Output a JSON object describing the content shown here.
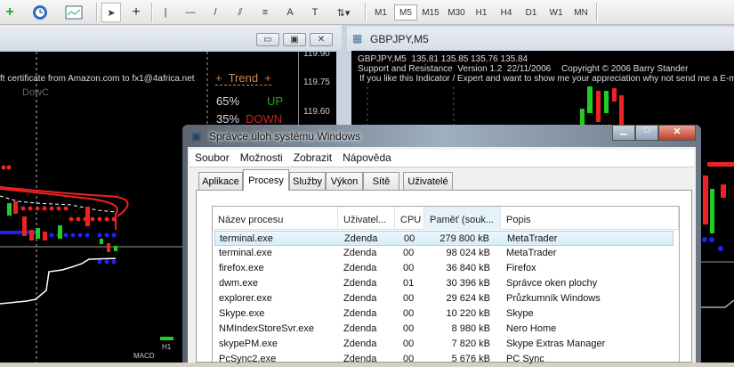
{
  "toolbar": {
    "icons": [
      "new-chart-icon",
      "clock-icon",
      "indicators-icon",
      "cursor-icon",
      "crosshair-icon",
      "vertical-line-icon",
      "horizontal-line-icon",
      "trendline-icon",
      "equidistant-channel-icon",
      "fibonacci-icon",
      "text-icon",
      "text-label-icon",
      "arrows-icon"
    ],
    "text_tool": "A",
    "timeframes": [
      "M1",
      "M5",
      "M15",
      "M30",
      "H1",
      "H4",
      "D1",
      "W1",
      "MN"
    ],
    "active_timeframe": "M5"
  },
  "left_chart": {
    "banner": "ft certificate   from Amazon.com to fx1@4africa.net",
    "dow_label": "DowC",
    "trend_title": "+  Trend  +",
    "up_pct": "65%",
    "up_label": "UP",
    "down_pct": "35%",
    "down_label": "DOWN",
    "prices": [
      "119.90",
      "119.75",
      "119.60"
    ],
    "macd_label": "MACD",
    "h1_label": "H1"
  },
  "right_chart": {
    "title": "GBPJPY,M5",
    "line1": "GBPJPY,M5  135.81 135.85 135.76 135.84",
    "line2": "Support and Resistance  Version 1.2  22/11/2006",
    "copyright": "Copyright © 2006 Barry Stander",
    "line3": "If you like this Indicator / Expert and want to show me your appreciation why not send me a   E-mail"
  },
  "taskmgr": {
    "title": "Správce úloh systému Windows",
    "menu": [
      "Soubor",
      "Možnosti",
      "Zobrazit",
      "Nápověda"
    ],
    "tabs": [
      "Aplikace",
      "Procesy",
      "Služby",
      "Výkon",
      "Sítě",
      "Uživatelé"
    ],
    "active_tab": "Procesy",
    "columns": [
      "Název procesu",
      "Uživatel...",
      "CPU",
      "Paměť (souk...",
      "Popis"
    ],
    "rows": [
      {
        "name": "terminal.exe",
        "user": "Zdenda",
        "cpu": "00",
        "mem": "279 800 kB",
        "desc": "MetaTrader"
      },
      {
        "name": "terminal.exe",
        "user": "Zdenda",
        "cpu": "00",
        "mem": "98 024 kB",
        "desc": "MetaTrader"
      },
      {
        "name": "firefox.exe",
        "user": "Zdenda",
        "cpu": "00",
        "mem": "36 840 kB",
        "desc": "Firefox"
      },
      {
        "name": "dwm.exe",
        "user": "Zdenda",
        "cpu": "01",
        "mem": "30 396 kB",
        "desc": "Správce oken plochy"
      },
      {
        "name": "explorer.exe",
        "user": "Zdenda",
        "cpu": "00",
        "mem": "29 624 kB",
        "desc": "Průzkumník Windows"
      },
      {
        "name": "Skype.exe",
        "user": "Zdenda",
        "cpu": "00",
        "mem": "10 220 kB",
        "desc": "Skype"
      },
      {
        "name": "NMIndexStoreSvr.exe",
        "user": "Zdenda",
        "cpu": "00",
        "mem": "8 980 kB",
        "desc": "Nero Home"
      },
      {
        "name": "skypePM.exe",
        "user": "Zdenda",
        "cpu": "00",
        "mem": "7 820 kB",
        "desc": "Skype Extras Manager"
      },
      {
        "name": "PcSync2.exe",
        "user": "Zdenda",
        "cpu": "00",
        "mem": "5 676 kB",
        "desc": "PC Sync"
      }
    ]
  }
}
